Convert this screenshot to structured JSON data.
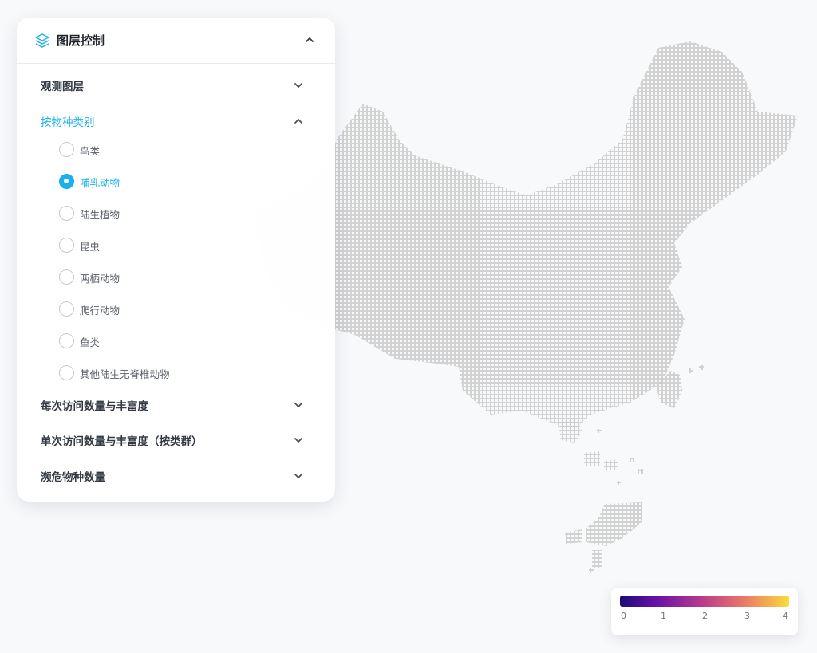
{
  "panel": {
    "title": "图层控制",
    "icon": "layers-icon",
    "accent_color": "#1ab0ec",
    "sections": [
      {
        "label": "观测图层",
        "expanded": false
      },
      {
        "label": "按物种类别",
        "expanded": true
      },
      {
        "label": "每次访问数量与丰富度",
        "expanded": false
      },
      {
        "label": "单次访问数量与丰富度（按类群）",
        "expanded": false
      },
      {
        "label": "濒危物种数量",
        "expanded": false
      }
    ],
    "species_options": [
      {
        "label": "鸟类",
        "selected": false
      },
      {
        "label": "哺乳动物",
        "selected": true
      },
      {
        "label": "陆生植物",
        "selected": false
      },
      {
        "label": "昆虫",
        "selected": false
      },
      {
        "label": "两栖动物",
        "selected": false
      },
      {
        "label": "爬行动物",
        "selected": false
      },
      {
        "label": "鱼类",
        "selected": false
      },
      {
        "label": "其他陆生无脊椎动物",
        "selected": false
      }
    ]
  },
  "legend": {
    "ticks": [
      "0",
      "1",
      "2",
      "3",
      "4"
    ],
    "colors": [
      "#1c0a7a",
      "#6a11a8",
      "#b83a8a",
      "#e8746a",
      "#f9dc3a"
    ]
  },
  "map": {
    "grid_color": "#c8c8c8"
  }
}
